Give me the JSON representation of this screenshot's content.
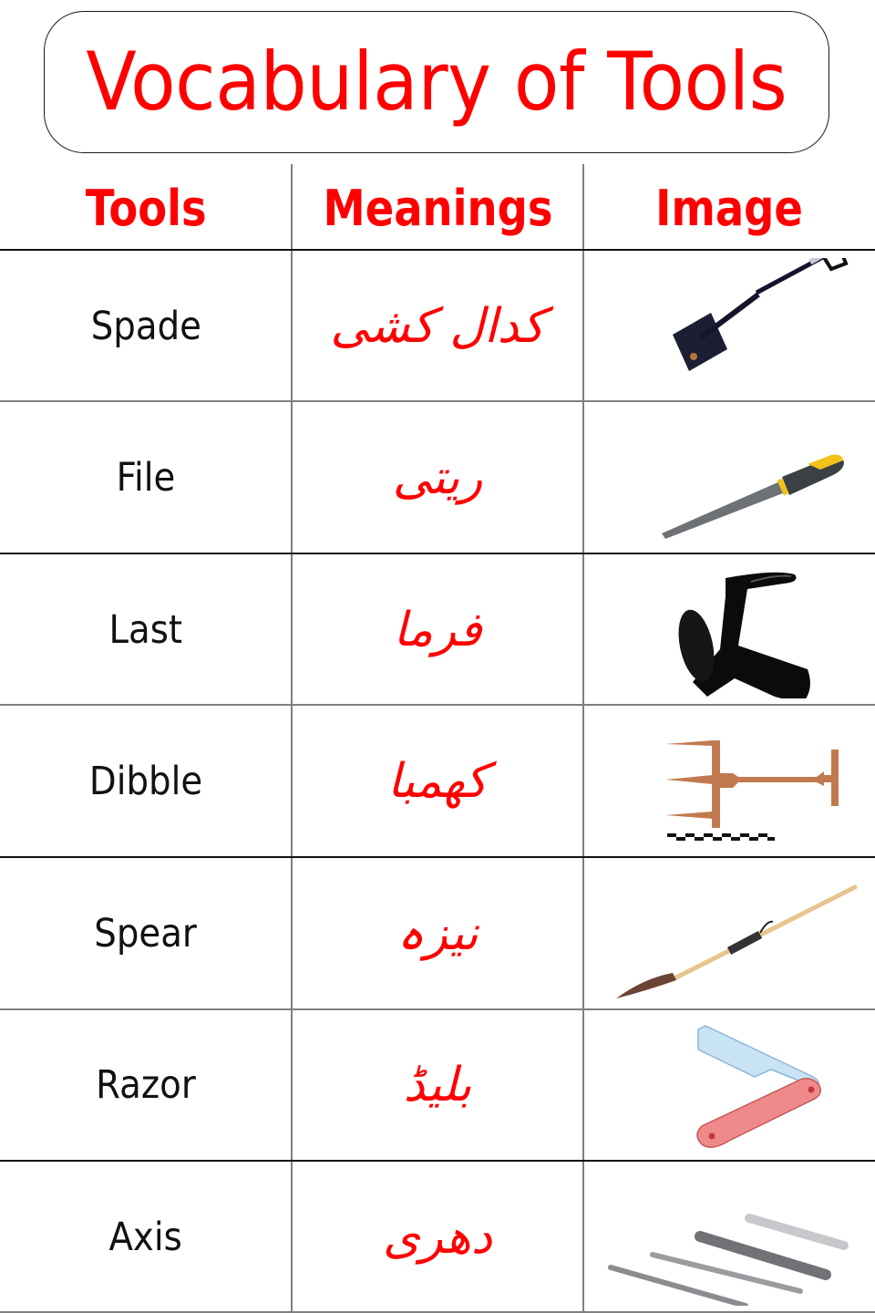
{
  "title": "Vocabulary of Tools",
  "headers": {
    "tools": "Tools",
    "meanings": "Meanings",
    "image": "Image"
  },
  "colors": {
    "accent": "#ff0000",
    "text": "#111111",
    "grid_dark": "#111111",
    "grid_light": "#7f7f7f"
  },
  "rows": [
    {
      "term": "Spade",
      "meaning": "کدال کشی",
      "image": "spade-image"
    },
    {
      "term": "File",
      "meaning": "ریتی",
      "image": "file-image"
    },
    {
      "term": "Last",
      "meaning": "فرما",
      "image": "shoe-last-image"
    },
    {
      "term": "Dibble",
      "meaning": "کھمبا",
      "image": "dibble-image"
    },
    {
      "term": "Spear",
      "meaning": "نیزہ",
      "image": "spear-image"
    },
    {
      "term": "Razor",
      "meaning": "بلیڈ",
      "image": "razor-image"
    },
    {
      "term": "Axis",
      "meaning": "دھری",
      "image": "drill-bits-image"
    }
  ]
}
